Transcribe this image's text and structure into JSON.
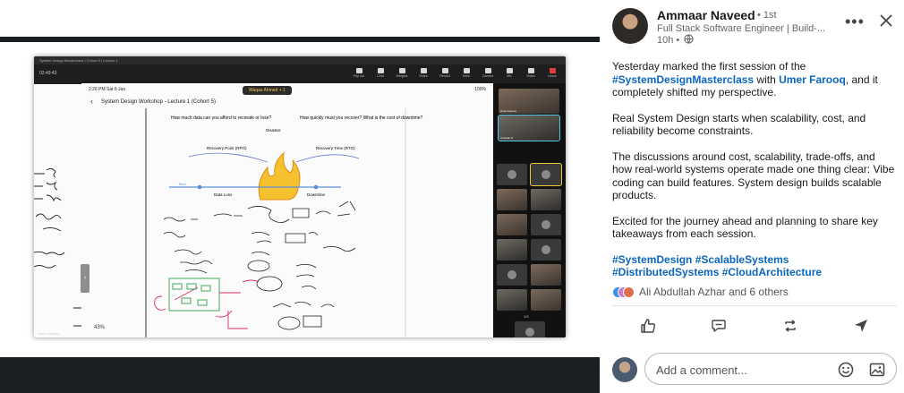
{
  "viewer": {
    "zoom_window": {
      "title": "System Design Masterclass | Cohort 5 | Lecture 1",
      "recording": "02:49:43",
      "toolbar": [
        {
          "label": "Pop out"
        },
        {
          "label": "Chat"
        },
        {
          "label": "Widgets"
        },
        {
          "label": "Share"
        },
        {
          "label": "Record"
        },
        {
          "label": "More"
        },
        {
          "label": "Camera"
        },
        {
          "label": "Mic"
        },
        {
          "label": "Share"
        },
        {
          "label": "Leave"
        }
      ]
    },
    "whiteboard": {
      "status_time": "2:26 PM  Sat 6 Jun",
      "status_right": "100%",
      "banner": "Waqas Ahmed + 1",
      "title": "System Design Workshop - Lecture 1 (Cohort 5)",
      "q1": "How much data can you afford to recreate or lose?",
      "q2": "How quickly must you recover? What is the cost of downtime?",
      "disaster": "Disaster",
      "rpo_label": "Recovery Point (RPO)",
      "rto_label": "Recovery Time (RTO)",
      "data_loss": "Data Loss",
      "downtime": "Downtime",
      "time": "Time",
      "zoom_level": "43%"
    },
    "gallery": [
      {
        "name": "Umer Farooq"
      },
      {
        "name": "Ammaar N"
      }
    ],
    "gallery_page": "1/3",
    "footer_name": "Umer Farooq"
  },
  "post": {
    "author": "Ammaar Naveed",
    "degree": "• 1st",
    "headline": "Full Stack Software Engineer | Build-...",
    "time": "10h •",
    "body": {
      "p1_a": "Yesterday marked the first session of the ",
      "p1_tag": "#SystemDesignMasterclass",
      "p1_b": " with ",
      "p1_mention": "Umer Farooq",
      "p1_c": ", and it completely shifted my perspective.",
      "p2": "Real System Design starts when scalability, cost, and reliability become constraints.",
      "p3": "The discussions around cost, scalability, trade-offs, and how real-world systems operate made one thing clear: Vibe coding can build features. System design builds scalable products.",
      "p4": "Excited for the journey ahead and planning to share key takeaways from each session.",
      "hashtags": "#SystemDesign #ScalableSystems #DistributedSystems #CloudArchitecture"
    },
    "reactions": "Ali Abdullah Azhar and 6 others",
    "comment_placeholder": "Add a comment..."
  },
  "colors": {
    "link": "#0a66c2",
    "text": "#191919",
    "muted": "#666666"
  }
}
